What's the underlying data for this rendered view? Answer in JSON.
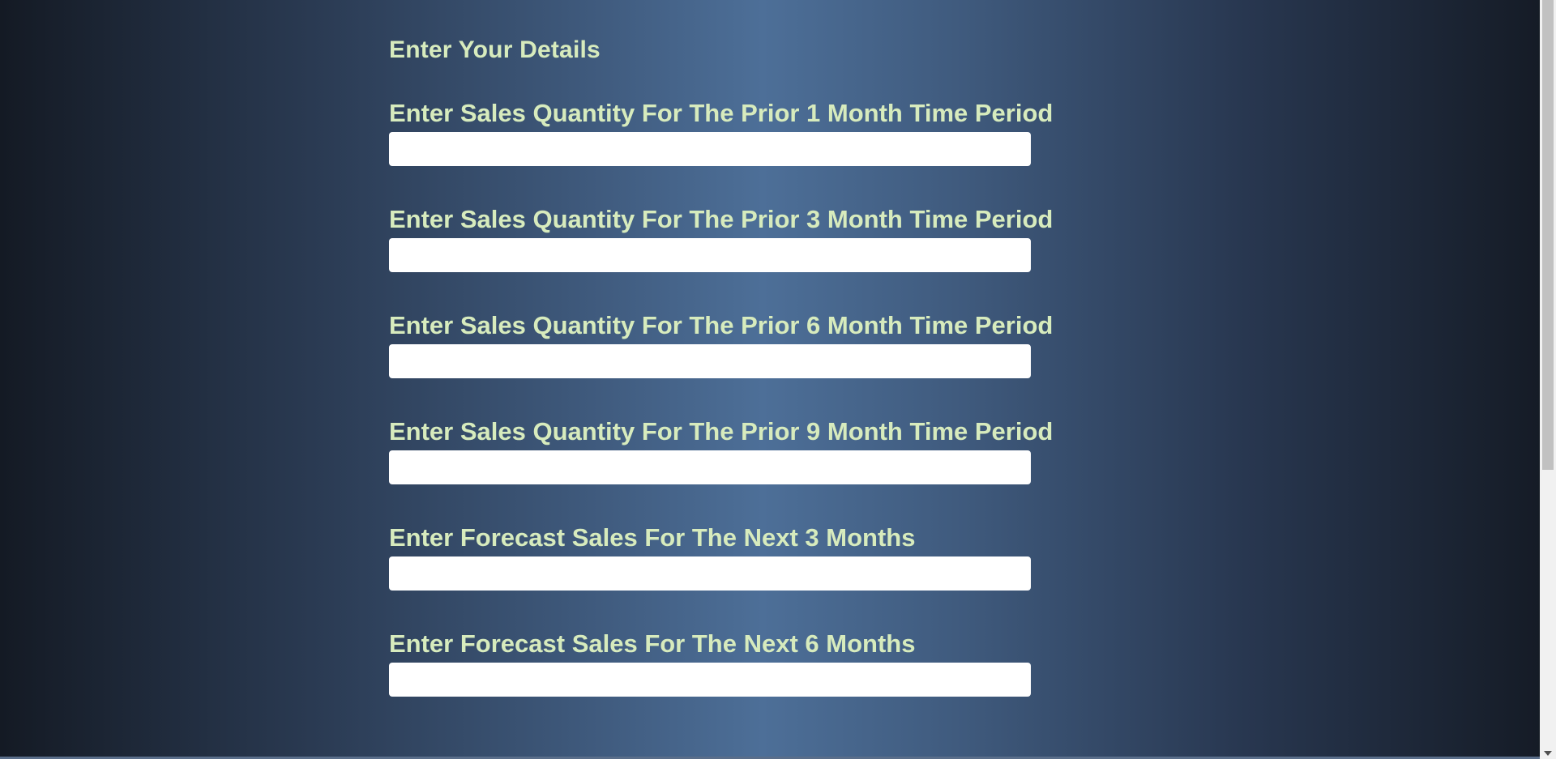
{
  "form": {
    "title": "Enter Your Details",
    "fields": [
      {
        "label": "Enter Sales Quantity For The Prior 1 Month Time Period",
        "value": ""
      },
      {
        "label": "Enter Sales Quantity For The Prior 3 Month Time Period",
        "value": ""
      },
      {
        "label": "Enter Sales Quantity For The Prior 6 Month Time Period",
        "value": ""
      },
      {
        "label": "Enter Sales Quantity For The Prior 9 Month Time Period",
        "value": ""
      },
      {
        "label": "Enter Forecast Sales For The Next 3 Months",
        "value": ""
      },
      {
        "label": "Enter Forecast Sales For The Next 6 Months",
        "value": ""
      }
    ]
  },
  "colors": {
    "label_text": "#d7ebbd",
    "input_background": "#ffffff",
    "background_center": "#4d6f98",
    "background_edge": "#141a24"
  }
}
